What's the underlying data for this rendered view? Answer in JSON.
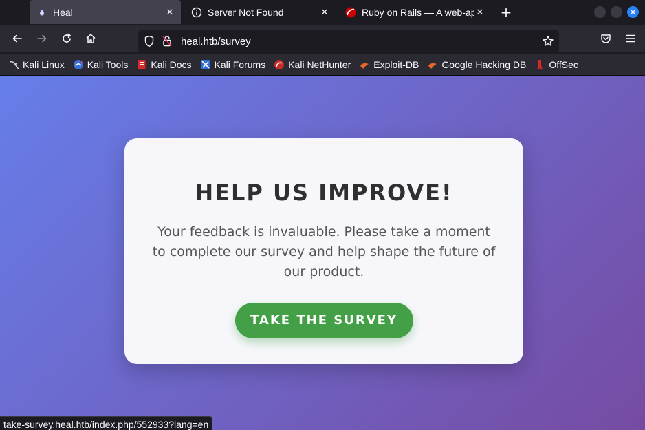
{
  "tabs": [
    {
      "title": "Heal",
      "icon": "heal-favicon-icon",
      "active": true
    },
    {
      "title": "Server Not Found",
      "icon": "info-icon",
      "active": false
    },
    {
      "title": "Ruby on Rails — A web-ap",
      "icon": "rails-favicon-icon",
      "active": false
    }
  ],
  "tab_close_glyph": "✕",
  "new_tab_glyph": "+",
  "window_close_glyph": "✕",
  "url": "heal.htb/survey",
  "bookmarks": [
    {
      "label": "Kali Linux",
      "icon": "kali-linux-icon"
    },
    {
      "label": "Kali Tools",
      "icon": "kali-tools-icon"
    },
    {
      "label": "Kali Docs",
      "icon": "kali-docs-icon"
    },
    {
      "label": "Kali Forums",
      "icon": "kali-forums-icon"
    },
    {
      "label": "Kali NetHunter",
      "icon": "kali-nethunter-icon"
    },
    {
      "label": "Exploit-DB",
      "icon": "exploit-db-icon"
    },
    {
      "label": "Google Hacking DB",
      "icon": "google-hacking-db-icon"
    },
    {
      "label": "OffSec",
      "icon": "offsec-icon"
    }
  ],
  "card": {
    "title": "HELP US IMPROVE!",
    "text": "Your feedback is invaluable. Please take a moment to complete our survey and help shape the future of our product.",
    "button": "TAKE THE SURVEY"
  },
  "status_url": "take-survey.heal.htb/index.php/552933?lang=en",
  "colors": {
    "gradient_start": "#667eea",
    "gradient_end": "#764ba2",
    "button": "#43a047",
    "card": "#f7f7fb"
  }
}
